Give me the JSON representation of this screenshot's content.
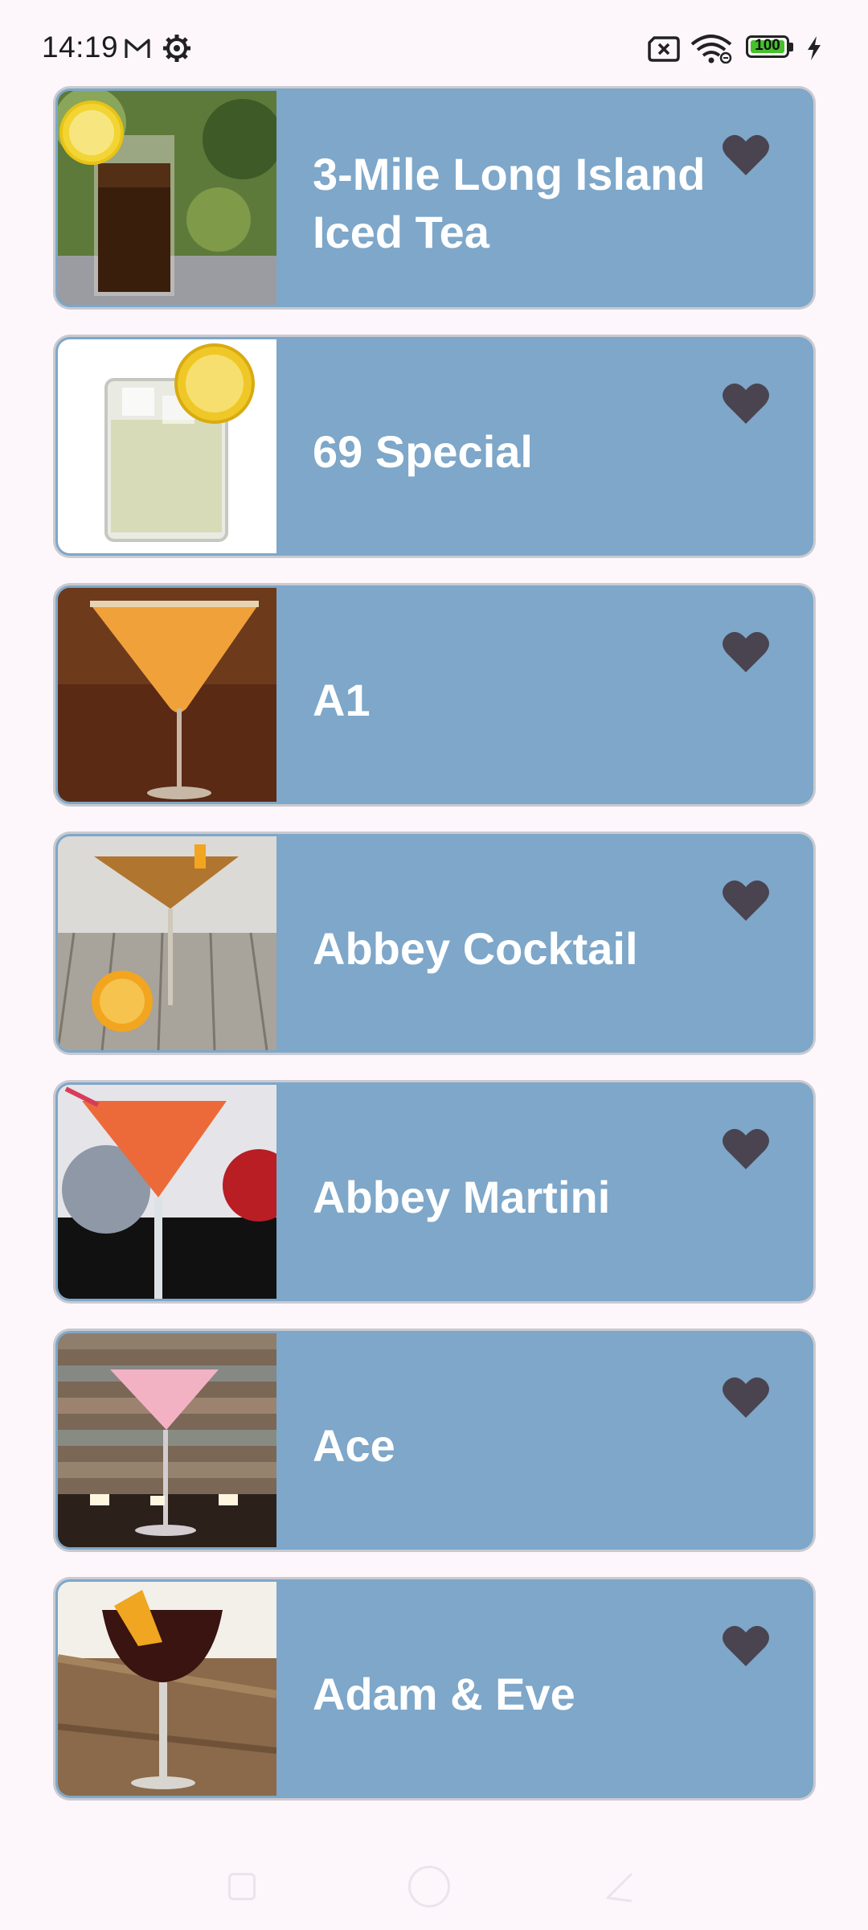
{
  "status_bar": {
    "time": "14:19",
    "icons": [
      "gmail-icon",
      "gear-icon",
      "sim-x-icon",
      "wifi-icon",
      "battery-icon",
      "charging-bolt-icon"
    ],
    "battery_level": "100",
    "battery_color": "#45c12a"
  },
  "cocktails": [
    {
      "name": "3-Mile Long Island Iced Tea",
      "image": "cocktail-photo"
    },
    {
      "name": "69 Special",
      "image": "cocktail-photo"
    },
    {
      "name": "A1",
      "image": "cocktail-photo"
    },
    {
      "name": "Abbey Cocktail",
      "image": "cocktail-photo"
    },
    {
      "name": "Abbey Martini",
      "image": "cocktail-photo"
    },
    {
      "name": "Ace",
      "image": "cocktail-photo"
    },
    {
      "name": "Adam & Eve",
      "image": "cocktail-photo"
    }
  ],
  "colors": {
    "card_background": "#7ea7c9",
    "heart": "#4a4450",
    "page_background": "#fdf7fc"
  },
  "nav_bar": {
    "icons": [
      "recent-apps-icon",
      "home-icon",
      "back-icon"
    ]
  }
}
